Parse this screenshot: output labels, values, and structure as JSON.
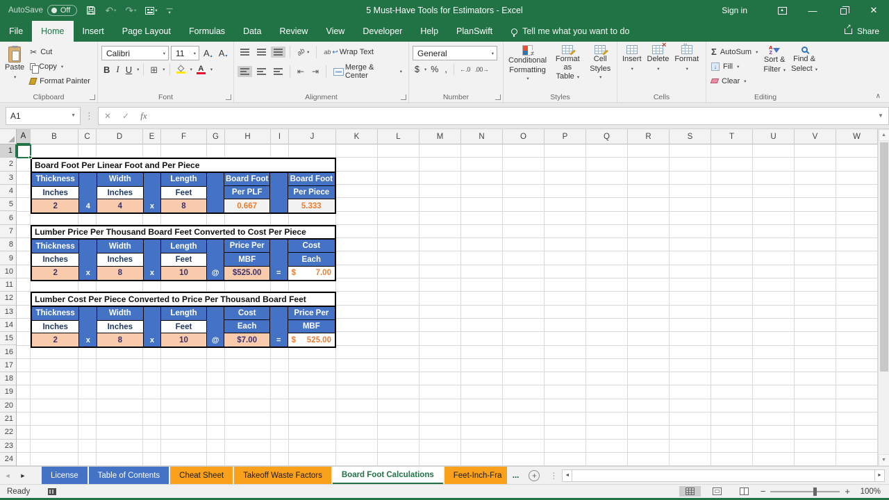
{
  "titlebar": {
    "autosave_label": "AutoSave",
    "autosave_state": "Off",
    "title": "5 Must-Have Tools for Estimators  -  Excel",
    "sign_in": "Sign in"
  },
  "ribbon_tabs": {
    "tabs": [
      "File",
      "Home",
      "Insert",
      "Page Layout",
      "Formulas",
      "Data",
      "Review",
      "View",
      "Developer",
      "Help",
      "PlanSwift"
    ],
    "active_tab": "Home",
    "tell_me": "Tell me what you want to do",
    "share": "Share"
  },
  "ribbon": {
    "clipboard": {
      "group_label": "Clipboard",
      "paste_label": "Paste",
      "cut_label": "Cut",
      "copy_label": "Copy",
      "format_painter_label": "Format Painter"
    },
    "font": {
      "group_label": "Font",
      "font_name": "Calibri",
      "font_size": "11",
      "bold_label": "B",
      "italic_label": "I",
      "underline_label": "U"
    },
    "alignment": {
      "group_label": "Alignment",
      "wrap_text_label": "Wrap Text",
      "merge_center_label": "Merge & Center"
    },
    "number": {
      "group_label": "Number",
      "format_value": "General",
      "currency_label": "$",
      "percent_label": "%",
      "comma_label": ",",
      "increase_decimal_label": "←.0",
      "decrease_decimal_label": ".00→"
    },
    "styles": {
      "group_label": "Styles",
      "conditional_line1": "Conditional",
      "conditional_line2": "Formatting",
      "format_table_line1": "Format as",
      "format_table_line2": "Table",
      "cell_styles_line1": "Cell",
      "cell_styles_line2": "Styles"
    },
    "cells": {
      "group_label": "Cells",
      "insert_label": "Insert",
      "delete_label": "Delete",
      "format_label": "Format"
    },
    "editing": {
      "group_label": "Editing",
      "autosum_label": "AutoSum",
      "fill_label": "Fill",
      "clear_label": "Clear",
      "sort_line1": "Sort &",
      "sort_line2": "Filter",
      "find_line1": "Find &",
      "find_line2": "Select"
    }
  },
  "formula_bar": {
    "name_box_value": "A1",
    "fx_label": "fx",
    "formula_value": ""
  },
  "grid": {
    "selected_cell": "A1",
    "columns": [
      "A",
      "B",
      "C",
      "D",
      "E",
      "F",
      "G",
      "H",
      "I",
      "J",
      "K",
      "L",
      "M",
      "N",
      "O",
      "P",
      "Q",
      "R",
      "S",
      "T",
      "U",
      "V",
      "W"
    ],
    "row_count": 24
  },
  "tables": [
    {
      "title": "Board Foot Per Linear Foot and Per Piece",
      "row_start": 2,
      "header1": [
        "Thickness",
        "Width",
        "Length",
        "Board Foot",
        "Board Foot"
      ],
      "header2": [
        "Inches",
        "Inches",
        "Feet",
        "Per PLF",
        "Per Piece"
      ],
      "separators": [
        "4",
        "x",
        "",
        ""
      ],
      "values": [
        "2",
        "4",
        "8",
        "0.667",
        "5.333"
      ],
      "value_kinds": [
        "input",
        "input",
        "input",
        "result",
        "result"
      ],
      "result_bg": "#F2F2F2"
    },
    {
      "title": "Lumber Price Per Thousand Board Feet Converted to Cost Per Piece",
      "row_start": 7,
      "header1": [
        "Thickness",
        "Width",
        "Length",
        "Price Per",
        "Cost"
      ],
      "header2": [
        "Inches",
        "Inches",
        "Feet",
        "MBF",
        "Each"
      ],
      "separators": [
        "x",
        "x",
        "@",
        "="
      ],
      "values": [
        "2",
        "8",
        "10",
        "$525.00",
        {
          "cur": "$",
          "num": "7.00"
        }
      ],
      "value_kinds": [
        "input",
        "input",
        "input",
        "input",
        "result"
      ],
      "result_bg": "#FFFFFF"
    },
    {
      "title": "Lumber Cost Per Piece Converted to Price Per Thousand Board Feet",
      "row_start": 12,
      "header1": [
        "Thickness",
        "Width",
        "Length",
        "Cost",
        "Price Per"
      ],
      "header2": [
        "Inches",
        "Inches",
        "Feet",
        "Each",
        "MBF"
      ],
      "separators": [
        "x",
        "x",
        "@",
        "="
      ],
      "values": [
        "2",
        "8",
        "10",
        "$7.00",
        {
          "cur": "$",
          "num": "525.00"
        }
      ],
      "value_kinds": [
        "input",
        "input",
        "input",
        "input",
        "result"
      ],
      "result_bg": "#FFFFFF"
    }
  ],
  "sheet_tabs": {
    "tabs": [
      {
        "label": "License",
        "color": "blue"
      },
      {
        "label": "Table of Contents",
        "color": "blue"
      },
      {
        "label": "Cheat Sheet",
        "color": "gold"
      },
      {
        "label": "Takeoff Waste Factors",
        "color": "gold"
      },
      {
        "label": "Board Foot Calculations",
        "color": "active"
      },
      {
        "label": "Feet-Inch-Fra",
        "color": "gold",
        "truncated": true
      }
    ],
    "overflow_indicator": "..."
  },
  "status_bar": {
    "status": "Ready",
    "zoom_level": "100%"
  },
  "colors": {
    "excel_green": "#217346",
    "table_blue": "#4472C4",
    "input_tan": "#F8CBAD",
    "result_orange": "#ED7D31",
    "value_purple": "#3F3168",
    "header_navy": "#1F3864",
    "tab_gold": "#F9A11B"
  }
}
